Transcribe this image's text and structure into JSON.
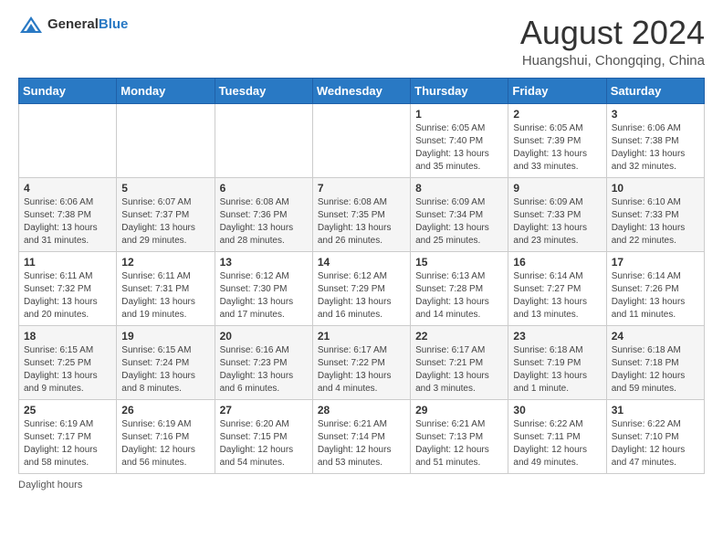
{
  "header": {
    "logo_general": "General",
    "logo_blue": "Blue",
    "month_year": "August 2024",
    "location": "Huangshui, Chongqing, China"
  },
  "weekdays": [
    "Sunday",
    "Monday",
    "Tuesday",
    "Wednesday",
    "Thursday",
    "Friday",
    "Saturday"
  ],
  "weeks": [
    [
      {
        "day": "",
        "info": ""
      },
      {
        "day": "",
        "info": ""
      },
      {
        "day": "",
        "info": ""
      },
      {
        "day": "",
        "info": ""
      },
      {
        "day": "1",
        "info": "Sunrise: 6:05 AM\nSunset: 7:40 PM\nDaylight: 13 hours\nand 35 minutes."
      },
      {
        "day": "2",
        "info": "Sunrise: 6:05 AM\nSunset: 7:39 PM\nDaylight: 13 hours\nand 33 minutes."
      },
      {
        "day": "3",
        "info": "Sunrise: 6:06 AM\nSunset: 7:38 PM\nDaylight: 13 hours\nand 32 minutes."
      }
    ],
    [
      {
        "day": "4",
        "info": "Sunrise: 6:06 AM\nSunset: 7:38 PM\nDaylight: 13 hours\nand 31 minutes."
      },
      {
        "day": "5",
        "info": "Sunrise: 6:07 AM\nSunset: 7:37 PM\nDaylight: 13 hours\nand 29 minutes."
      },
      {
        "day": "6",
        "info": "Sunrise: 6:08 AM\nSunset: 7:36 PM\nDaylight: 13 hours\nand 28 minutes."
      },
      {
        "day": "7",
        "info": "Sunrise: 6:08 AM\nSunset: 7:35 PM\nDaylight: 13 hours\nand 26 minutes."
      },
      {
        "day": "8",
        "info": "Sunrise: 6:09 AM\nSunset: 7:34 PM\nDaylight: 13 hours\nand 25 minutes."
      },
      {
        "day": "9",
        "info": "Sunrise: 6:09 AM\nSunset: 7:33 PM\nDaylight: 13 hours\nand 23 minutes."
      },
      {
        "day": "10",
        "info": "Sunrise: 6:10 AM\nSunset: 7:33 PM\nDaylight: 13 hours\nand 22 minutes."
      }
    ],
    [
      {
        "day": "11",
        "info": "Sunrise: 6:11 AM\nSunset: 7:32 PM\nDaylight: 13 hours\nand 20 minutes."
      },
      {
        "day": "12",
        "info": "Sunrise: 6:11 AM\nSunset: 7:31 PM\nDaylight: 13 hours\nand 19 minutes."
      },
      {
        "day": "13",
        "info": "Sunrise: 6:12 AM\nSunset: 7:30 PM\nDaylight: 13 hours\nand 17 minutes."
      },
      {
        "day": "14",
        "info": "Sunrise: 6:12 AM\nSunset: 7:29 PM\nDaylight: 13 hours\nand 16 minutes."
      },
      {
        "day": "15",
        "info": "Sunrise: 6:13 AM\nSunset: 7:28 PM\nDaylight: 13 hours\nand 14 minutes."
      },
      {
        "day": "16",
        "info": "Sunrise: 6:14 AM\nSunset: 7:27 PM\nDaylight: 13 hours\nand 13 minutes."
      },
      {
        "day": "17",
        "info": "Sunrise: 6:14 AM\nSunset: 7:26 PM\nDaylight: 13 hours\nand 11 minutes."
      }
    ],
    [
      {
        "day": "18",
        "info": "Sunrise: 6:15 AM\nSunset: 7:25 PM\nDaylight: 13 hours\nand 9 minutes."
      },
      {
        "day": "19",
        "info": "Sunrise: 6:15 AM\nSunset: 7:24 PM\nDaylight: 13 hours\nand 8 minutes."
      },
      {
        "day": "20",
        "info": "Sunrise: 6:16 AM\nSunset: 7:23 PM\nDaylight: 13 hours\nand 6 minutes."
      },
      {
        "day": "21",
        "info": "Sunrise: 6:17 AM\nSunset: 7:22 PM\nDaylight: 13 hours\nand 4 minutes."
      },
      {
        "day": "22",
        "info": "Sunrise: 6:17 AM\nSunset: 7:21 PM\nDaylight: 13 hours\nand 3 minutes."
      },
      {
        "day": "23",
        "info": "Sunrise: 6:18 AM\nSunset: 7:19 PM\nDaylight: 13 hours\nand 1 minute."
      },
      {
        "day": "24",
        "info": "Sunrise: 6:18 AM\nSunset: 7:18 PM\nDaylight: 12 hours\nand 59 minutes."
      }
    ],
    [
      {
        "day": "25",
        "info": "Sunrise: 6:19 AM\nSunset: 7:17 PM\nDaylight: 12 hours\nand 58 minutes."
      },
      {
        "day": "26",
        "info": "Sunrise: 6:19 AM\nSunset: 7:16 PM\nDaylight: 12 hours\nand 56 minutes."
      },
      {
        "day": "27",
        "info": "Sunrise: 6:20 AM\nSunset: 7:15 PM\nDaylight: 12 hours\nand 54 minutes."
      },
      {
        "day": "28",
        "info": "Sunrise: 6:21 AM\nSunset: 7:14 PM\nDaylight: 12 hours\nand 53 minutes."
      },
      {
        "day": "29",
        "info": "Sunrise: 6:21 AM\nSunset: 7:13 PM\nDaylight: 12 hours\nand 51 minutes."
      },
      {
        "day": "30",
        "info": "Sunrise: 6:22 AM\nSunset: 7:11 PM\nDaylight: 12 hours\nand 49 minutes."
      },
      {
        "day": "31",
        "info": "Sunrise: 6:22 AM\nSunset: 7:10 PM\nDaylight: 12 hours\nand 47 minutes."
      }
    ]
  ],
  "footer": {
    "note": "Daylight hours"
  }
}
